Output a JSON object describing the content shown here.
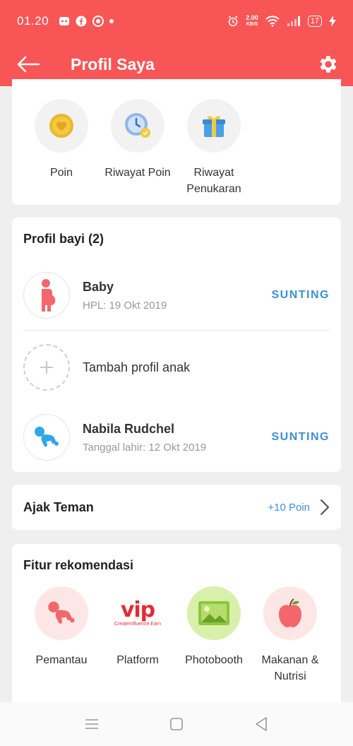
{
  "status_bar": {
    "time": "01.20",
    "net_speed_value": "2.00",
    "net_speed_unit": "KB/S",
    "battery": "17"
  },
  "app_bar": {
    "title": "Profil Saya"
  },
  "points": {
    "items": [
      {
        "label": "Poin",
        "icon": "coin-heart-icon"
      },
      {
        "label": "Riwayat Poin",
        "icon": "clock-history-icon"
      },
      {
        "label": "Riwayat Penukaran",
        "icon": "gift-icon"
      }
    ]
  },
  "baby_profiles": {
    "title": "Profil bayi (2)",
    "items": [
      {
        "name": "Baby",
        "sub": "HPL: 19 Okt 2019",
        "action": "SUNTING"
      },
      {
        "name": "Nabila Rudchel",
        "sub": "Tanggal lahir: 12 Okt 2019",
        "action": "SUNTING"
      }
    ],
    "add_label": "Tambah profil anak"
  },
  "invite": {
    "label": "Ajak Teman",
    "points": "+10 Poin"
  },
  "recommended": {
    "title": "Fitur rekomendasi",
    "items": [
      {
        "label": "Pemantau",
        "icon": "crawling-baby-icon"
      },
      {
        "label": "Platform",
        "icon": "vip-logo-icon",
        "logo_text": "vip",
        "logo_sub": "CreateInfluence.Earn"
      },
      {
        "label": "Photobooth",
        "icon": "image-icon"
      },
      {
        "label": "Makanan & Nutrisi",
        "icon": "apple-icon"
      }
    ]
  },
  "colors": {
    "brand": "#f75556",
    "link": "#3c8fd6"
  }
}
